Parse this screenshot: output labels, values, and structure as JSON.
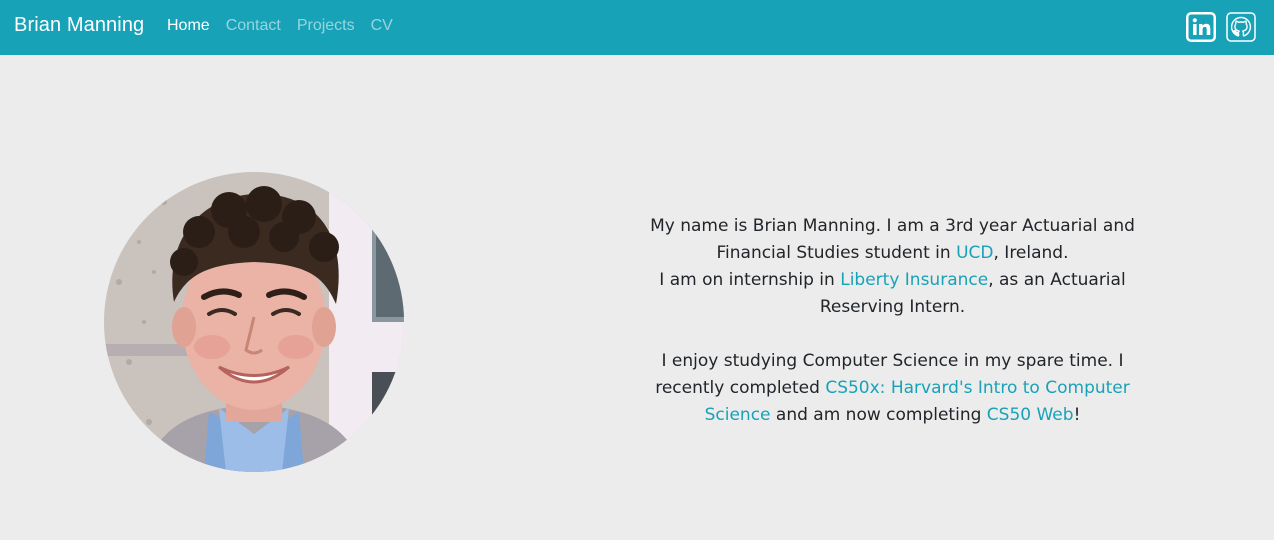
{
  "navbar": {
    "brand": "Brian Manning",
    "links": [
      {
        "label": "Home",
        "active": true
      },
      {
        "label": "Contact",
        "active": false
      },
      {
        "label": "Projects",
        "active": false
      },
      {
        "label": "CV",
        "active": false
      }
    ],
    "social_icons": [
      "linkedin-icon",
      "github-icon"
    ]
  },
  "profile": {
    "photo_alt": "Brian Manning"
  },
  "bio": {
    "p1_a": "My name is Brian Manning. I am a 3rd year Actuarial and Financial Studies student in ",
    "p1_link1": "UCD",
    "p1_b": ", Ireland.",
    "p1_c": "I am on internship in ",
    "p1_link2": "Liberty Insurance",
    "p1_d": ", as an Actuarial Reserving Intern.",
    "p2_a": "I enjoy studying Computer Science in my spare time. I recently completed ",
    "p2_link1": "CS50x: Harvard's Intro to Computer Science",
    "p2_b": " and am now completing ",
    "p2_link2": "CS50 Web",
    "p2_c": "!"
  },
  "colors": {
    "navbar_bg": "#17a2b8",
    "page_bg": "#ececec",
    "link": "#17a2b8",
    "text": "#212529"
  }
}
